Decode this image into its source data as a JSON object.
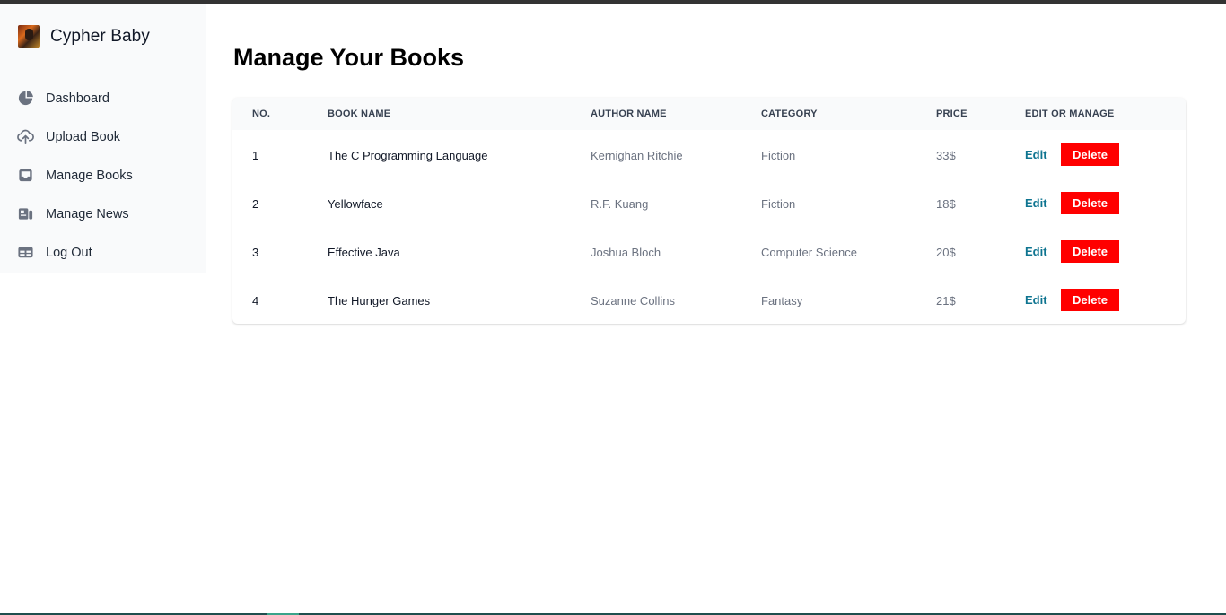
{
  "sidebar": {
    "brand": "Cypher Baby",
    "items": [
      {
        "label": "Dashboard",
        "icon": "pie-chart-icon"
      },
      {
        "label": "Upload Book",
        "icon": "cloud-upload-icon"
      },
      {
        "label": "Manage Books",
        "icon": "inbox-icon"
      },
      {
        "label": "Manage News",
        "icon": "news-icon"
      },
      {
        "label": "Log Out",
        "icon": "table-icon"
      }
    ]
  },
  "main": {
    "title": "Manage Your Books",
    "table": {
      "headers": [
        "NO.",
        "BOOK NAME",
        "AUTHOR NAME",
        "CATEGORY",
        "PRICE",
        "EDIT OR MANAGE"
      ],
      "rows": [
        {
          "no": "1",
          "name": "The C Programming Language",
          "author": "Kernighan Ritchie",
          "category": "Fiction",
          "price": "33$"
        },
        {
          "no": "2",
          "name": "Yellowface",
          "author": "R.F. Kuang",
          "category": "Fiction",
          "price": "18$"
        },
        {
          "no": "3",
          "name": "Effective Java",
          "author": "Joshua Bloch",
          "category": "Computer Science",
          "price": "20$"
        },
        {
          "no": "4",
          "name": "The Hunger Games",
          "author": "Suzanne Collins",
          "category": "Fantasy",
          "price": "21$"
        }
      ],
      "edit_label": "Edit",
      "delete_label": "Delete"
    }
  },
  "colors": {
    "sidebar_bg": "#f9fafb",
    "delete_button": "#ff0000",
    "edit_link": "#0e7490",
    "icon": "#6b7280"
  }
}
